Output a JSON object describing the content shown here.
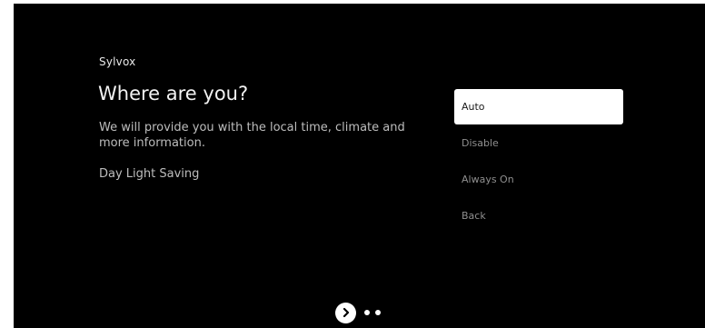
{
  "brand": "Sylvox",
  "heading": {
    "title": "Where are you?",
    "subtitle": "We will provide you with the local time, climate and more information.",
    "setting_label": "Day Light Saving"
  },
  "options": [
    {
      "label": "Auto",
      "selected": true
    },
    {
      "label": "Disable",
      "selected": false
    },
    {
      "label": "Always On",
      "selected": false
    },
    {
      "label": "Back",
      "selected": false
    }
  ],
  "pager": {
    "next_icon": "chevron-right-icon",
    "page_dots": 2
  },
  "colors": {
    "background": "#000000",
    "selected_option_bg": "#ffffff",
    "text_primary": "#f2f2f2",
    "text_secondary": "#bdbdbd",
    "text_muted": "#8f8f8f"
  }
}
